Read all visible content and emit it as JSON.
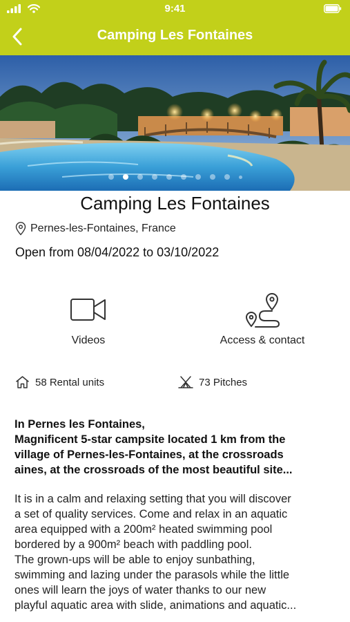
{
  "status_bar": {
    "time": "9:41",
    "icons": [
      "signal-icon",
      "wifi-icon",
      "battery-icon"
    ]
  },
  "nav": {
    "title": "Camping Les Fontaines",
    "back_icon": "back-chevron-icon"
  },
  "colors": {
    "brand": "#c2d01a",
    "text": "#111111"
  },
  "gallery": {
    "image_description": "Illuminated swimming pool at dusk",
    "page_count": 10,
    "active_page": 2
  },
  "campsite": {
    "name": "Camping Les Fontaines",
    "location": "Pernes-les-Fontaines, France",
    "location_icon": "location-pin-icon",
    "opening": "Open from 08/04/2022 to 03/10/2022"
  },
  "actions": [
    {
      "label": "Videos",
      "icon": "video-camera-icon"
    },
    {
      "label": "Access & contact",
      "icon": "route-map-icon"
    }
  ],
  "stats": {
    "rental_units": "58 Rental units",
    "rental_icon": "house-icon",
    "pitches": "73 Pitches",
    "pitches_icon": "tent-icon"
  },
  "description": {
    "intro_lines": [
      "In Pernes les Fontaines,",
      "Magnificent 5-star campsite located 1 km from the",
      "village of Pernes-les-Fontaines, at the crossroads",
      "aines, at the crossroads of the most beautiful site..."
    ],
    "body_lines": [
      "It is in a calm and relaxing setting that you will discover",
      "a set of quality services. Come and relax in an aquatic",
      "area equipped with a 200m² heated swimming pool",
      "bordered by a 900m² beach with paddling pool.",
      "The grown-ups will be able to enjoy sunbathing,",
      "swimming and lazing under the parasols while the little",
      "ones will learn the joys of water thanks to our new",
      "playful aquatic area with slide, animations and aquatic..."
    ]
  }
}
